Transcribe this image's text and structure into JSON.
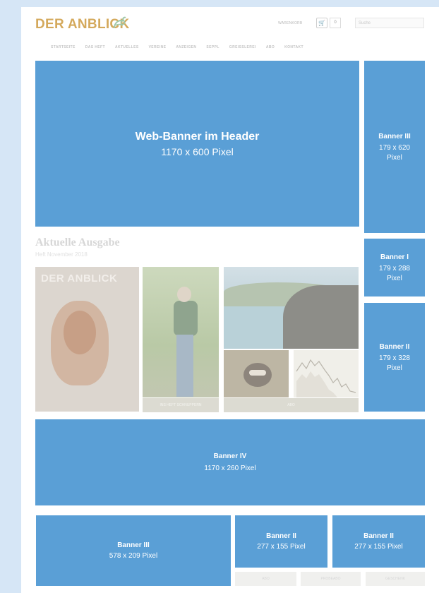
{
  "header": {
    "logo_text": "DER ANBLICK",
    "cart_label": "WARENKORB",
    "cart_count": "0",
    "search_placeholder": "Suche"
  },
  "nav": {
    "items": [
      "STARTSEITE",
      "DAS HEFT",
      "AKTUELLES",
      "VEREINE",
      "ANZEIGEN",
      "SEPPL",
      "GREISSLEREI",
      "ABO",
      "KONTAKT"
    ]
  },
  "banners": {
    "header": {
      "title": "Web-Banner im Header",
      "size": "1170 x 600 Pixel"
    },
    "side_top": {
      "title": "Banner III",
      "size": "179 x 620",
      "unit": "Pixel"
    },
    "side_mid": {
      "title": "Banner I",
      "size": "179 x 288",
      "unit": "Pixel"
    },
    "side_low": {
      "title": "Banner II",
      "size": "179 x 328",
      "unit": "Pixel"
    },
    "wide": {
      "title": "Banner IV",
      "size": "1170 x 260 Pixel"
    },
    "bottom_left": {
      "title": "Banner III",
      "size": "578 x 209 Pixel"
    },
    "bottom_mid": {
      "title": "Banner II",
      "size": "277 x 155 Pixel"
    },
    "bottom_right": {
      "title": "Banner II",
      "size": "277 x 155 Pixel"
    }
  },
  "issue": {
    "title": "Aktuelle Ausgabe",
    "subtitle": "Heft November 2018",
    "cover_title": "DER ANBLICK",
    "btn_heft": "INS HEFT SCHNUPPERN",
    "btn_abo": "ABO"
  },
  "footer_buttons": [
    "ABO",
    "PROBEABO",
    "GESCHENK"
  ],
  "colors": {
    "page_background": "#d6e6f6",
    "banner": "#5a9fd6",
    "logo": "#d4a95c"
  }
}
